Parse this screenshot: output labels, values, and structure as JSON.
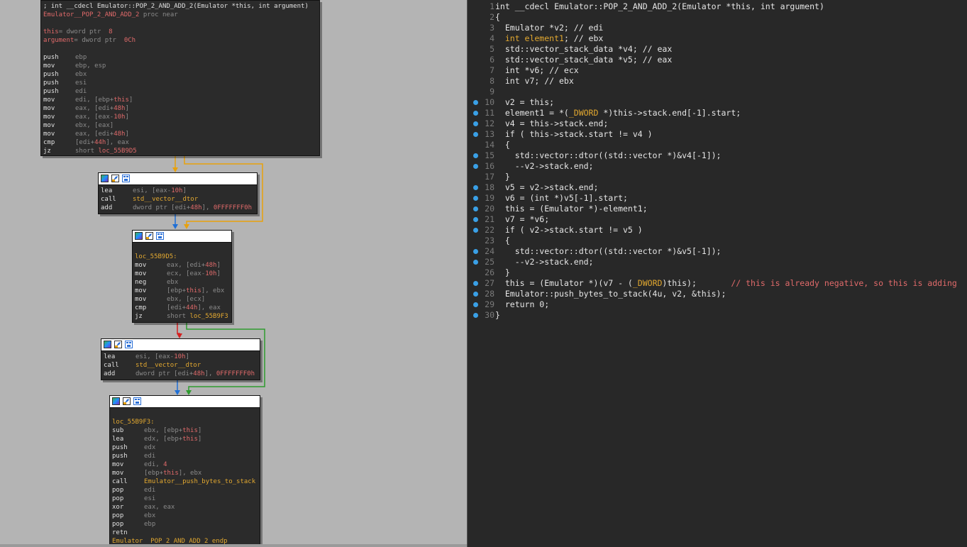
{
  "graph": {
    "block1": {
      "lines": [
        {
          "text": "; int __cdecl Emulator::POP_2_AND_ADD_2(Emulator *this, int argument)"
        },
        {
          "a": "Emulator__POP_2_AND_ADD_2",
          "b": " proc near"
        },
        {
          "text": ""
        },
        {
          "a": "this",
          "b": "= dword ptr  ",
          "c": "8"
        },
        {
          "a": "argument",
          "b": "= dword ptr  ",
          "c": "0Ch"
        },
        {
          "text": ""
        },
        {
          "mn": "push",
          "op": "ebp"
        },
        {
          "mn": "mov",
          "op": "ebp, esp"
        },
        {
          "mn": "push",
          "op": "ebx"
        },
        {
          "mn": "push",
          "op": "esi"
        },
        {
          "mn": "push",
          "op": "edi"
        },
        {
          "mn": "mov",
          "op": "edi, [ebp+",
          "op_h": "this",
          "op2": "]"
        },
        {
          "mn": "mov",
          "op": "eax, [edi+",
          "op_h": "48h",
          "op2": "]"
        },
        {
          "mn": "mov",
          "op": "eax, [eax-",
          "op_h": "10h",
          "op2": "]"
        },
        {
          "mn": "mov",
          "op": "ebx, [eax]"
        },
        {
          "mn": "mov",
          "op": "eax, [edi+",
          "op_h": "48h",
          "op2": "]"
        },
        {
          "mn": "cmp",
          "op": "[edi+",
          "op_h": "44h",
          "op2": "], eax"
        },
        {
          "mn": "jz",
          "op": "short ",
          "op_h": "loc_55B9D5"
        }
      ]
    },
    "block2": {
      "lines": [
        {
          "mn": "lea",
          "op": "esi, [eax-",
          "op_h": "10h",
          "op2": "]"
        },
        {
          "mn": "call",
          "op_hl": "std__vector__dtor"
        },
        {
          "mn": "add",
          "op": "dword ptr [edi+",
          "op_h": "48h",
          "op2": "], ",
          "op_p": "0FFFFFFF0h"
        }
      ]
    },
    "block3": {
      "lines": [
        {
          "text": ""
        },
        {
          "label": "loc_55B9D5:"
        },
        {
          "mn": "mov",
          "op": "eax, [edi+",
          "op_h": "48h",
          "op2": "]"
        },
        {
          "mn": "mov",
          "op": "ecx, [eax-",
          "op_h": "10h",
          "op2": "]"
        },
        {
          "mn": "neg",
          "op": "ebx"
        },
        {
          "mn": "mov",
          "op": "[ebp+",
          "op_h": "this",
          "op2": "], ebx"
        },
        {
          "mn": "mov",
          "op": "ebx, [ecx]"
        },
        {
          "mn": "cmp",
          "op": "[edi+",
          "op_h": "44h",
          "op2": "], eax"
        },
        {
          "mn": "jz",
          "op": "short ",
          "op_hl": "loc_55B9F3"
        }
      ]
    },
    "block4": {
      "lines": [
        {
          "mn": "lea",
          "op": "esi, [eax-",
          "op_h": "10h",
          "op2": "]"
        },
        {
          "mn": "call",
          "op_hl": "std__vector__dtor"
        },
        {
          "mn": "add",
          "op": "dword ptr [edi+",
          "op_h": "48h",
          "op2": "], ",
          "op_p": "0FFFFFFF0h"
        }
      ]
    },
    "block5": {
      "lines": [
        {
          "text": ""
        },
        {
          "label": "loc_55B9F3:"
        },
        {
          "mn": "sub",
          "op": "ebx, [ebp+",
          "op_h": "this",
          "op2": "]"
        },
        {
          "mn": "lea",
          "op": "edx, [ebp+",
          "op_h": "this",
          "op2": "]"
        },
        {
          "mn": "push",
          "op": "edx"
        },
        {
          "mn": "push",
          "op": "edi"
        },
        {
          "mn": "mov",
          "op": "edi, ",
          "op_p": "4"
        },
        {
          "mn": "mov",
          "op": "[ebp+",
          "op_h": "this",
          "op2": "], ebx"
        },
        {
          "mn": "call",
          "op_hl": "Emulator__push_bytes_to_stack"
        },
        {
          "mn": "pop",
          "op": "edi"
        },
        {
          "mn": "pop",
          "op": "esi"
        },
        {
          "mn": "xor",
          "op": "eax, eax"
        },
        {
          "mn": "pop",
          "op": "ebx"
        },
        {
          "mn": "pop",
          "op": "ebp"
        },
        {
          "mn": "retn",
          "op": ""
        },
        {
          "label": "Emulator  POP 2 AND ADD 2 endp"
        }
      ]
    }
  },
  "pseudocode": {
    "lines": [
      {
        "n": "1",
        "dot": false,
        "parts": [
          [
            "",
            "int __cdecl Emulator::POP_2_AND_ADD_2(Emulator *this, int argument)"
          ]
        ]
      },
      {
        "n": "2",
        "dot": false,
        "parts": [
          [
            "",
            "{"
          ]
        ]
      },
      {
        "n": "3",
        "dot": false,
        "parts": [
          [
            "",
            "  Emulator *v2; // edi"
          ]
        ]
      },
      {
        "n": "4",
        "dot": false,
        "parts": [
          [
            "h",
            "  int element1"
          ],
          [
            "",
            "; // ebx"
          ]
        ]
      },
      {
        "n": "5",
        "dot": false,
        "parts": [
          [
            "",
            "  std::vector_stack_data *v4; // eax"
          ]
        ]
      },
      {
        "n": "6",
        "dot": false,
        "parts": [
          [
            "",
            "  std::vector_stack_data *v5; // eax"
          ]
        ]
      },
      {
        "n": "7",
        "dot": false,
        "parts": [
          [
            "",
            "  int *v6; // ecx"
          ]
        ]
      },
      {
        "n": "8",
        "dot": false,
        "parts": [
          [
            "",
            "  int v7; // ebx"
          ]
        ]
      },
      {
        "n": "9",
        "dot": false,
        "parts": [
          [
            "",
            ""
          ]
        ]
      },
      {
        "n": "10",
        "dot": true,
        "parts": [
          [
            "",
            "  v2 = this;"
          ]
        ]
      },
      {
        "n": "11",
        "dot": true,
        "parts": [
          [
            "",
            "  element1 = *("
          ],
          [
            "h",
            "_DWORD"
          ],
          [
            "",
            " *)this->stack.end[-1].start;"
          ]
        ]
      },
      {
        "n": "12",
        "dot": true,
        "parts": [
          [
            "",
            "  v4 = this->stack.end;"
          ]
        ]
      },
      {
        "n": "13",
        "dot": true,
        "parts": [
          [
            "",
            "  if ( this->stack.start != v4 )"
          ]
        ]
      },
      {
        "n": "14",
        "dot": false,
        "parts": [
          [
            "",
            "  {"
          ]
        ]
      },
      {
        "n": "15",
        "dot": true,
        "parts": [
          [
            "",
            "    std::vector::dtor((std::vector *)&v4[-1]);"
          ]
        ]
      },
      {
        "n": "16",
        "dot": true,
        "parts": [
          [
            "",
            "    --v2->stack.end;"
          ]
        ]
      },
      {
        "n": "17",
        "dot": false,
        "parts": [
          [
            "",
            "  }"
          ]
        ]
      },
      {
        "n": "18",
        "dot": true,
        "parts": [
          [
            "",
            "  v5 = v2->stack.end;"
          ]
        ]
      },
      {
        "n": "19",
        "dot": true,
        "parts": [
          [
            "",
            "  v6 = (int *)v5[-1].start;"
          ]
        ]
      },
      {
        "n": "20",
        "dot": true,
        "parts": [
          [
            "",
            "  this = (Emulator *)-element1;"
          ]
        ]
      },
      {
        "n": "21",
        "dot": true,
        "parts": [
          [
            "",
            "  v7 = *v6;"
          ]
        ]
      },
      {
        "n": "22",
        "dot": true,
        "parts": [
          [
            "",
            "  if ( v2->stack.start != v5 )"
          ]
        ]
      },
      {
        "n": "23",
        "dot": false,
        "parts": [
          [
            "",
            "  {"
          ]
        ]
      },
      {
        "n": "24",
        "dot": true,
        "parts": [
          [
            "",
            "    std::vector::dtor((std::vector *)&v5[-1]);"
          ]
        ]
      },
      {
        "n": "25",
        "dot": true,
        "parts": [
          [
            "",
            "    --v2->stack.end;"
          ]
        ]
      },
      {
        "n": "26",
        "dot": false,
        "parts": [
          [
            "",
            "  }"
          ]
        ]
      },
      {
        "n": "27",
        "dot": true,
        "parts": [
          [
            "",
            "  this = (Emulator *)(v7 - ("
          ],
          [
            "h",
            "_DWORD"
          ],
          [
            "",
            ")this);       "
          ],
          [
            "p",
            "// this is already negative, so this is adding"
          ]
        ]
      },
      {
        "n": "28",
        "dot": true,
        "parts": [
          [
            "",
            "  Emulator::push_bytes_to_stack(4u, v2, &this);"
          ]
        ]
      },
      {
        "n": "29",
        "dot": true,
        "parts": [
          [
            "",
            "  return 0;"
          ]
        ]
      },
      {
        "n": "30",
        "dot": true,
        "parts": [
          [
            "",
            "}"
          ]
        ]
      }
    ]
  },
  "colors": {
    "edge_false": "#e8a10c",
    "edge_branch": "#1f6fd6",
    "edge_taken": "#2e9b2e",
    "edge_red": "#d42020",
    "breakpoint_dot": "#3aa0e6"
  }
}
